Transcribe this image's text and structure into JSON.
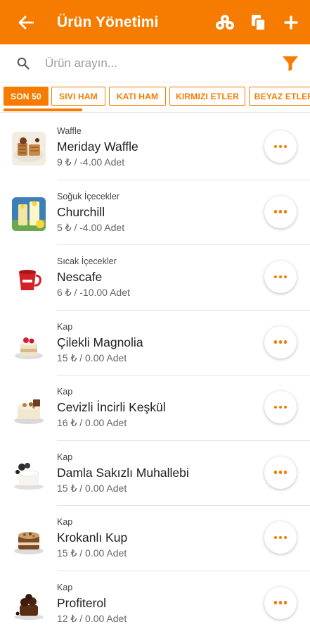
{
  "appbar": {
    "title": "Ürün Yönetimi",
    "back_icon": "arrow-left-icon",
    "actions": [
      "group-products-icon",
      "copy-icon",
      "plus-icon"
    ],
    "color": "#f57c00"
  },
  "search": {
    "placeholder": "Ürün arayın...",
    "value": "",
    "icon": "search-icon",
    "filter_icon": "filter-icon"
  },
  "tabs": [
    {
      "label": "SON 50",
      "active": true
    },
    {
      "label": "SIVI HAM",
      "active": false
    },
    {
      "label": "KATI HAM",
      "active": false
    },
    {
      "label": "KIRMIZI ETLER",
      "active": false
    },
    {
      "label": "BEYAZ ETLER",
      "active": false
    }
  ],
  "products": [
    {
      "category": "Waffle",
      "name": "Meriday Waffle",
      "price": "9 ₺ / -4.00 Adet",
      "image": "waffle-image"
    },
    {
      "category": "Soğuk İçecekler",
      "name": "Churchill",
      "price": "5 ₺ / -4.00 Adet",
      "image": "lemonade-image"
    },
    {
      "category": "Sıcak İçecekler",
      "name": "Nescafe",
      "price": "6 ₺ / -10.00 Adet",
      "image": "coffee-cup-image"
    },
    {
      "category": "Kap",
      "name": "Çilekli Magnolia",
      "price": "15 ₺ / 0.00 Adet",
      "image": "magnolia-image"
    },
    {
      "category": "Kap",
      "name": "Cevizli İncirli Keşkül",
      "price": "16 ₺ / 0.00 Adet",
      "image": "keskul-image"
    },
    {
      "category": "Kap",
      "name": "Damla Sakızlı Muhallebi",
      "price": "15 ₺ / 0.00 Adet",
      "image": "muhallebi-image"
    },
    {
      "category": "Kap",
      "name": "Krokanlı Kup",
      "price": "15 ₺ / 0.00 Adet",
      "image": "kup-image"
    },
    {
      "category": "Kap",
      "name": "Profiterol",
      "price": "12 ₺ / 0.00 Adet",
      "image": "profiterol-image"
    }
  ]
}
